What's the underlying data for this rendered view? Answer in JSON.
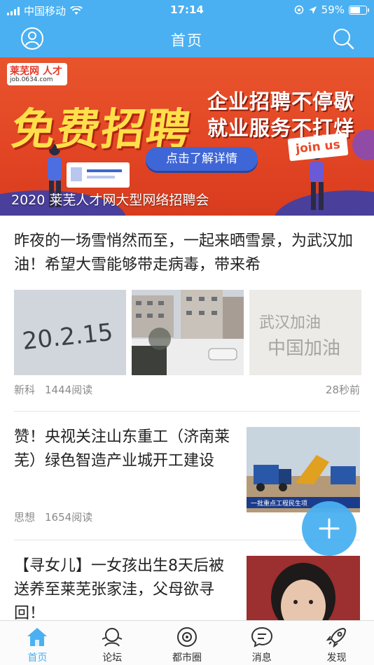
{
  "status_bar": {
    "carrier": "中国移动",
    "time": "17:14",
    "battery": "59%",
    "battery_level": 0.59
  },
  "header": {
    "title": "首页",
    "left_icon": "profile-icon",
    "right_icon": "search-icon"
  },
  "banner": {
    "caption": "2020 莱芜人才网大型网络招聘会",
    "logo_text": "莱芜网 人才",
    "logo_url": "job.0634.com",
    "slogan": "免费招聘",
    "sub_slogan_1": "企业招聘不停歇",
    "sub_slogan_2": "就业服务不打烊",
    "cta": "点击了解详情",
    "badge": "join us"
  },
  "feed": [
    {
      "title": "昨夜的一场雪悄然而至，一起来晒雪景，为武汉加油！希望大雪能够带走病毒，带来希",
      "author": "新科",
      "reads": "1444阅读",
      "time": "28秒前",
      "images": [
        "snow-written-20-2-15",
        "snowy-residential-buildings",
        "snow-written-wuhan-china"
      ]
    },
    {
      "title": "赞！央视关注山东重工（济南莱芜）绿色智造产业城开工建设",
      "author": "思想",
      "reads": "1654阅读",
      "image": "construction-site-news",
      "image_caption": "一批重点工程民生项"
    },
    {
      "title": "【寻女儿】一女孩出生8天后被送养至莱芜张家洼，父母欲寻回！",
      "image": "woman-portrait"
    }
  ],
  "fab": {
    "icon": "plus-icon"
  },
  "tabbar": {
    "items": [
      {
        "label": "首页",
        "icon": "home-icon",
        "active": true
      },
      {
        "label": "论坛",
        "icon": "forum-icon",
        "active": false
      },
      {
        "label": "都市圈",
        "icon": "circle-icon",
        "active": false
      },
      {
        "label": "消息",
        "icon": "message-icon",
        "active": false
      },
      {
        "label": "发现",
        "icon": "rocket-icon",
        "active": false
      }
    ]
  },
  "colors": {
    "primary": "#4ab0f2",
    "banner_red": "#e24524",
    "text": "#222222",
    "meta": "#8a8a8a"
  }
}
